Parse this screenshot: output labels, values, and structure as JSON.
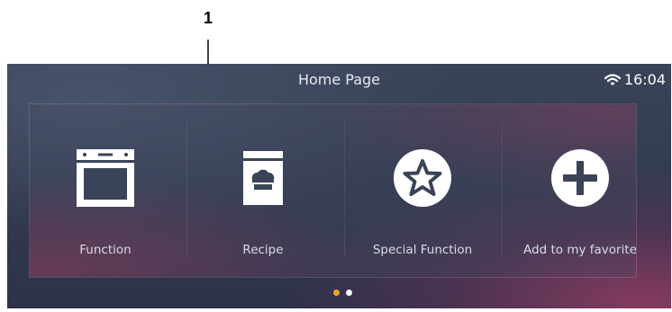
{
  "callout": {
    "number": "1"
  },
  "header": {
    "title": "Home Page",
    "time": "16:04"
  },
  "icons": {
    "wifi": "wifi-icon",
    "oven": "oven-icon",
    "recipe": "recipe-book-icon",
    "special": "star-icon",
    "favorite": "plus-icon"
  },
  "tiles": [
    {
      "label": "Function"
    },
    {
      "label": "Recipe"
    },
    {
      "label": "Special Function"
    },
    {
      "label": "Add to my favorite"
    }
  ],
  "pager": {
    "active_color": "#f0a030",
    "inactive_color": "#ffffff",
    "active_index": 0,
    "count": 2
  }
}
